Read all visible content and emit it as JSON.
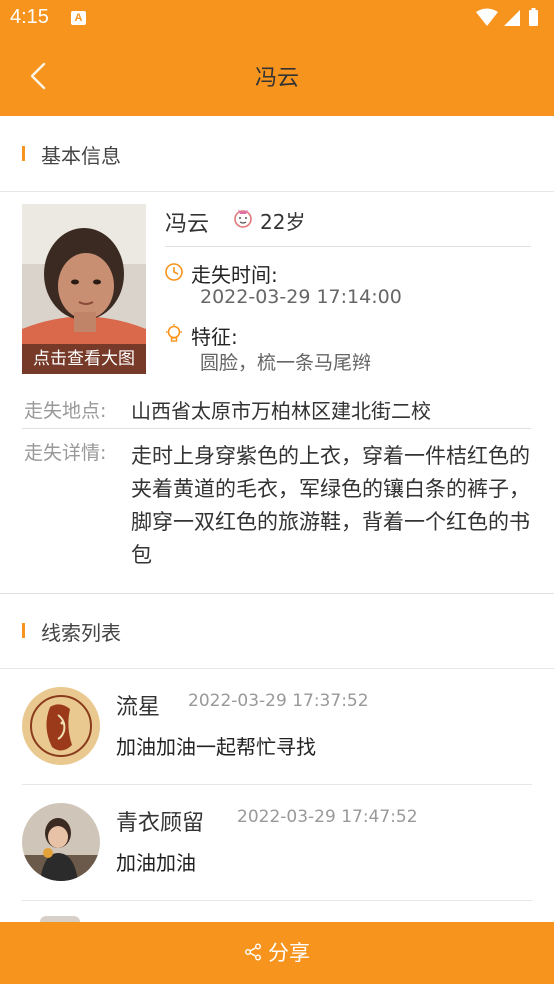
{
  "status_bar": {
    "time": "4:15",
    "notification": "A"
  },
  "header": {
    "title": "冯云"
  },
  "basic_info": {
    "section_title": "基本信息",
    "photo_caption": "点击查看大图",
    "name": "冯云",
    "age": "22岁",
    "missing_time_label": "走失时间:",
    "missing_time": "2022-03-29 17:14:00",
    "features_label": "特征:",
    "features": "圆脸，梳一条马尾辫",
    "location_label": "走失地点:",
    "location": "山西省太原市万柏林区建北街二校",
    "details_label": "走失详情:",
    "details": "走时上身穿紫色的上衣，穿着一件桔红色的夹着黄道的毛衣，军绿色的镶白条的裤子，脚穿一双红色的旅游鞋，背着一个红色的书包"
  },
  "clues": {
    "section_title": "线索列表",
    "items": [
      {
        "name": "流星",
        "time": "2022-03-29 17:37:52",
        "message": "加油加油一起帮忙寻找"
      },
      {
        "name": "青衣顾留",
        "time": "2022-03-29 17:47:52",
        "message": "加油加油"
      }
    ]
  },
  "footer": {
    "share_label": "分享"
  },
  "colors": {
    "accent": "#f7941d",
    "text": "#333333",
    "muted": "#999999"
  }
}
